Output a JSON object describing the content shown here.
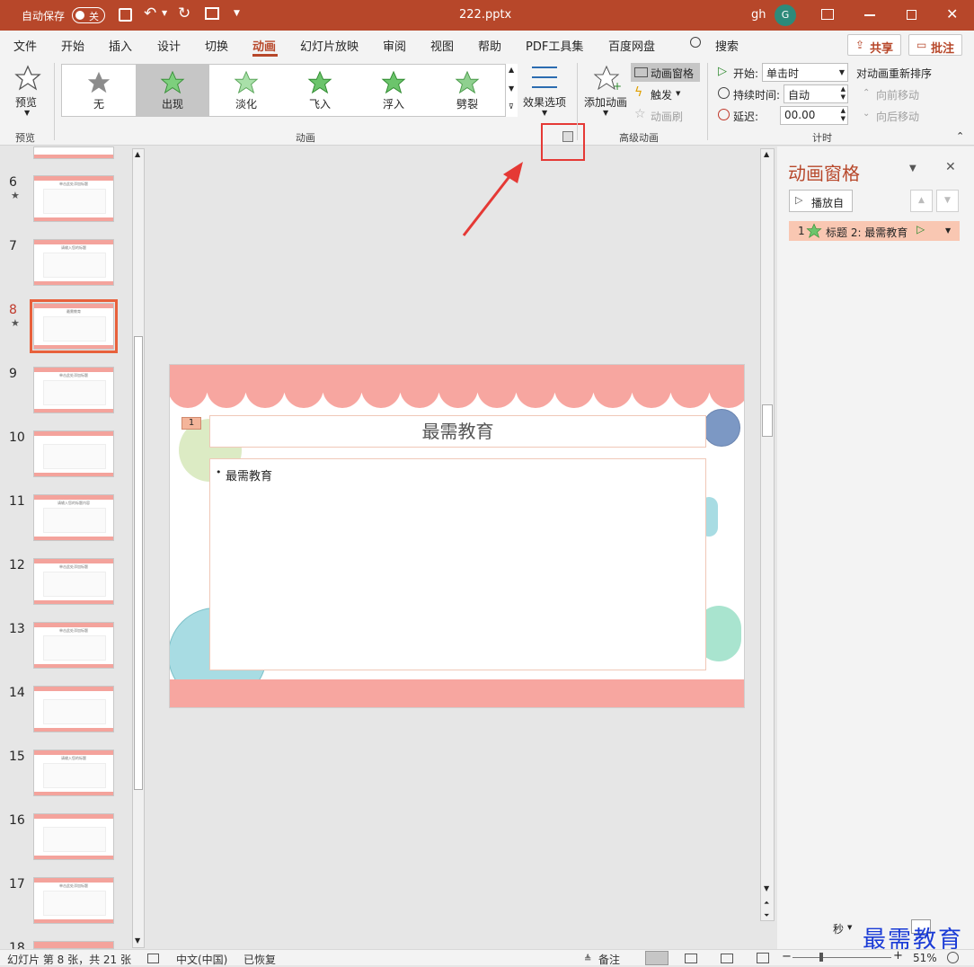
{
  "titlebar": {
    "autosave_label": "自动保存",
    "autosave_state": "关",
    "filename": "222.pptx",
    "user_initials": "gh",
    "avatar_letter": "G",
    "accent": "#b7472a"
  },
  "menu": {
    "tabs": [
      "文件",
      "开始",
      "插入",
      "设计",
      "切换",
      "动画",
      "幻灯片放映",
      "审阅",
      "视图",
      "帮助",
      "PDF工具集",
      "百度网盘"
    ],
    "active_tab": "动画",
    "search": "搜索",
    "share": "共享",
    "comments": "批注"
  },
  "ribbon": {
    "preview": {
      "button": "预览",
      "group": "预览"
    },
    "gallery": [
      "无",
      "出现",
      "淡化",
      "飞入",
      "浮入",
      "劈裂"
    ],
    "gallery_selected": "出现",
    "effect_options": "效果选项",
    "animation_group": "动画",
    "add_animation": "添加动画",
    "animation_pane": "动画窗格",
    "trigger": "触发",
    "animation_painter": "动画刷",
    "advanced_group": "高级动画",
    "start_label": "开始:",
    "start_value": "单击时",
    "duration_label": "持续时间:",
    "duration_value": "自动",
    "delay_label": "延迟:",
    "delay_value": "00.00",
    "reorder_title": "对动画重新排序",
    "move_earlier": "向前移动",
    "move_later": "向后移动",
    "timing_group": "计时"
  },
  "thumbnails": [
    {
      "num": "6",
      "star": "★",
      "title": "单击此处添加标题"
    },
    {
      "num": "7",
      "star": "",
      "title": "请输入您的标题"
    },
    {
      "num": "8",
      "star": "★",
      "title": "最需教育"
    },
    {
      "num": "9",
      "star": "",
      "title": "单击此处添加标题"
    },
    {
      "num": "10",
      "star": "",
      "title": ""
    },
    {
      "num": "11",
      "star": "",
      "title": "请输入您的标题内容"
    },
    {
      "num": "12",
      "star": "",
      "title": "单击此处添加标题"
    },
    {
      "num": "13",
      "star": "",
      "title": "单击此处添加标题"
    },
    {
      "num": "14",
      "star": "",
      "title": ""
    },
    {
      "num": "15",
      "star": "",
      "title": "请输入您的标题"
    },
    {
      "num": "16",
      "star": "",
      "title": ""
    },
    {
      "num": "17",
      "star": "",
      "title": "单击此处添加标题"
    },
    {
      "num": "18",
      "star": "",
      "title": ""
    }
  ],
  "selected_slide": "8",
  "slide": {
    "anim_tag": "1",
    "title": "最需教育",
    "bullet": "最需教育"
  },
  "anim_pane": {
    "title": "动画窗格",
    "play_from": "播放自",
    "item_index": "1",
    "item_label": "标题 2: 最需教育",
    "seconds_label": "秒"
  },
  "watermark": "最需教育",
  "status": {
    "slide_info": "幻灯片 第 8 张，共 21 张",
    "language": "中文(中国)",
    "recovered": "已恢复",
    "notes": "备注",
    "zoom": "51%"
  }
}
